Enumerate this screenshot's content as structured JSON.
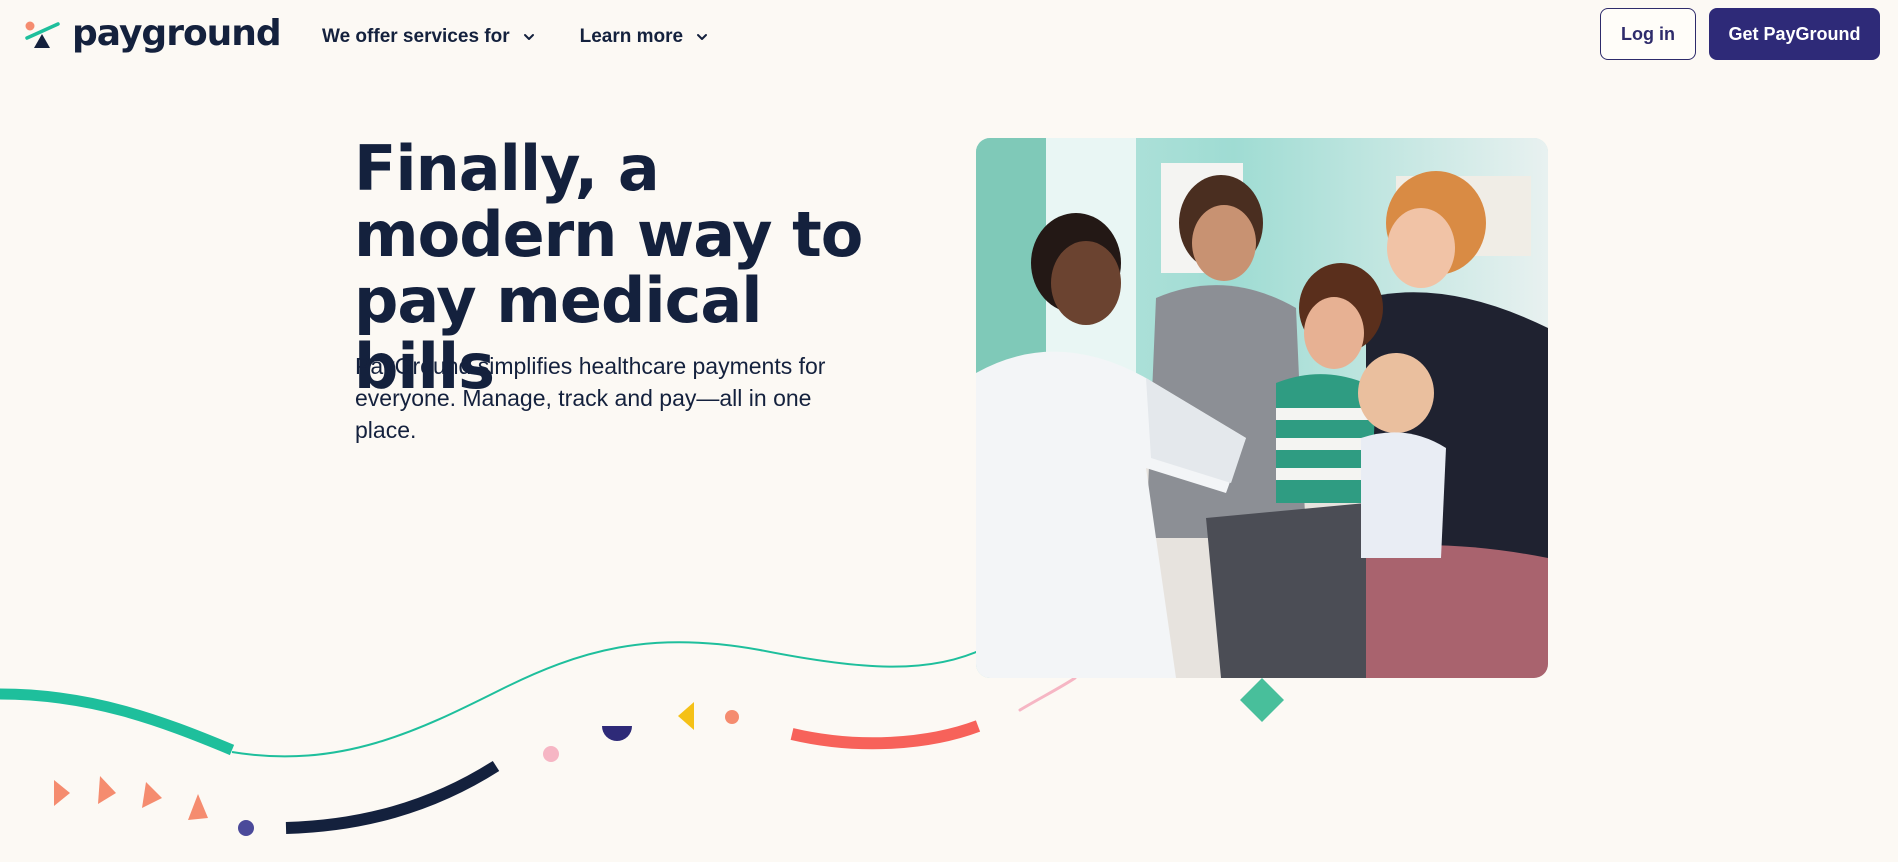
{
  "header": {
    "logo_text": "payground",
    "nav": [
      {
        "label": "We offer services for",
        "icon": "chevron-down-icon"
      },
      {
        "label": "Learn more",
        "icon": "chevron-down-icon"
      }
    ],
    "login_label": "Log in",
    "cta_label": "Get PayGround"
  },
  "hero": {
    "headline": "Finally, a modern way to pay medical bills",
    "subheadline": "PayGround simplifies healthcare payments for everyone. Manage, track and pay—all in one place.",
    "image": "photo-doctor-with-family"
  },
  "colors": {
    "background": "#fcf9f4",
    "navy": "#14213d",
    "brand_purple": "#2e2a78",
    "teal": "#1ebf9c",
    "coral": "#f7625a",
    "salmon": "#f58c6f",
    "pink": "#f6b6c4",
    "yellow": "#f5c117",
    "indigo_dot": "#4b4a9a"
  }
}
